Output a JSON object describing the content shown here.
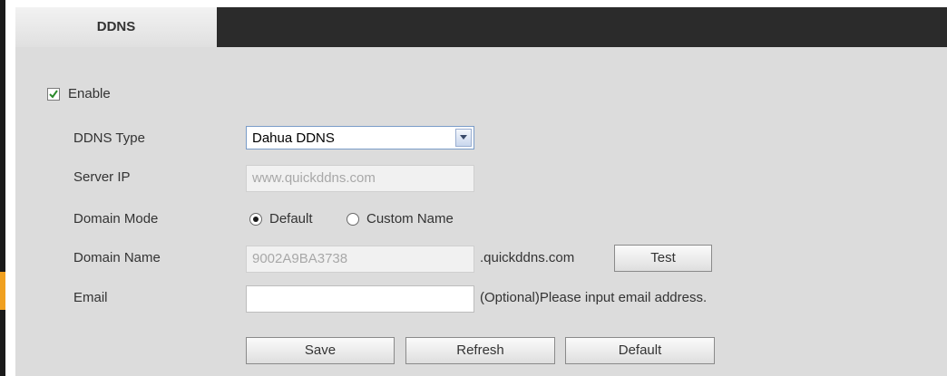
{
  "tabs": [
    {
      "label": "DDNS",
      "active": true
    }
  ],
  "enable": {
    "label": "Enable",
    "checked": true
  },
  "ddns_type": {
    "label": "DDNS Type",
    "value": "Dahua DDNS"
  },
  "server_ip": {
    "label": "Server IP",
    "value": "www.quickddns.com"
  },
  "domain_mode": {
    "label": "Domain Mode",
    "options": [
      {
        "label": "Default",
        "selected": true
      },
      {
        "label": "Custom Name",
        "selected": false
      }
    ]
  },
  "domain_name": {
    "label": "Domain Name",
    "value": "9002A9BA3738",
    "suffix": ".quickddns.com",
    "test_button": "Test"
  },
  "email": {
    "label": "Email",
    "value": "",
    "hint": "(Optional)Please input email address."
  },
  "buttons": {
    "save": "Save",
    "refresh": "Refresh",
    "default": "Default"
  },
  "colors": {
    "tab_bar": "#2b2b2b",
    "panel": "#dcdcdc",
    "accent": "#f0a020",
    "check": "#2a8a2a"
  }
}
